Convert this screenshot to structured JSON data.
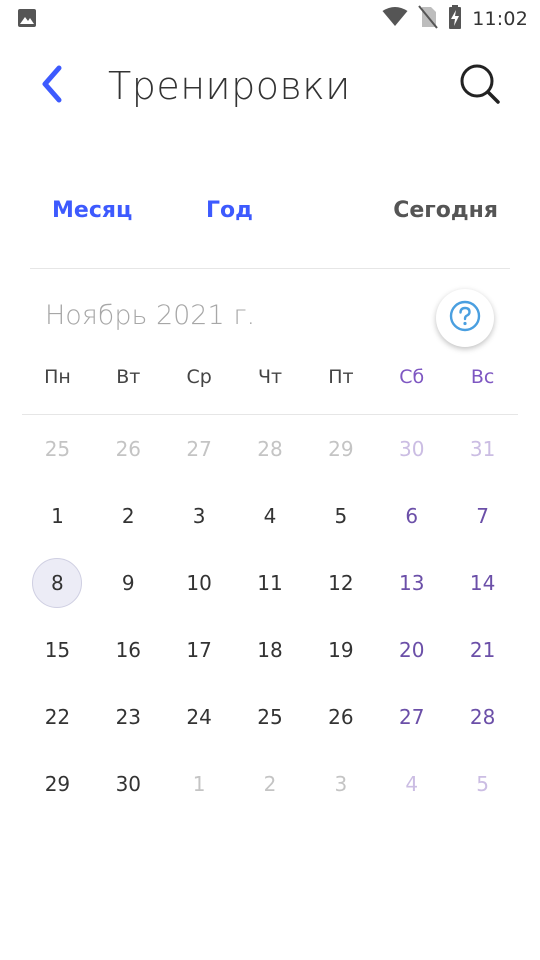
{
  "status_bar": {
    "time": "11:02",
    "left_icon": "image-icon",
    "icons": [
      "wifi-icon",
      "no-sim-icon",
      "battery-charging-icon"
    ]
  },
  "app_bar": {
    "title": "Тренировки",
    "back_icon": "back-arrow-icon",
    "search_icon": "search-icon",
    "accent_color": "#3D5AFE"
  },
  "tabs": {
    "month": "Месяц",
    "year": "Год",
    "today": "Сегодня"
  },
  "calendar": {
    "month_title": "Ноябрь 2021 г.",
    "help_icon": "help-circle-icon",
    "weekdays": [
      "Пн",
      "Вт",
      "Ср",
      "Чт",
      "Пт",
      "Сб",
      "Вс"
    ],
    "weeks": [
      [
        {
          "day": "25",
          "muted": true
        },
        {
          "day": "26",
          "muted": true
        },
        {
          "day": "27",
          "muted": true
        },
        {
          "day": "28",
          "muted": true
        },
        {
          "day": "29",
          "muted": true
        },
        {
          "day": "30",
          "muted": true
        },
        {
          "day": "31",
          "muted": true
        }
      ],
      [
        {
          "day": "1"
        },
        {
          "day": "2"
        },
        {
          "day": "3"
        },
        {
          "day": "4"
        },
        {
          "day": "5"
        },
        {
          "day": "6"
        },
        {
          "day": "7"
        }
      ],
      [
        {
          "day": "8",
          "today": true
        },
        {
          "day": "9"
        },
        {
          "day": "10"
        },
        {
          "day": "11"
        },
        {
          "day": "12"
        },
        {
          "day": "13"
        },
        {
          "day": "14"
        }
      ],
      [
        {
          "day": "15"
        },
        {
          "day": "16"
        },
        {
          "day": "17"
        },
        {
          "day": "18"
        },
        {
          "day": "19"
        },
        {
          "day": "20"
        },
        {
          "day": "21"
        }
      ],
      [
        {
          "day": "22"
        },
        {
          "day": "23"
        },
        {
          "day": "24"
        },
        {
          "day": "25"
        },
        {
          "day": "26"
        },
        {
          "day": "27"
        },
        {
          "day": "28"
        }
      ],
      [
        {
          "day": "29"
        },
        {
          "day": "30"
        },
        {
          "day": "1",
          "muted": true
        },
        {
          "day": "2",
          "muted": true
        },
        {
          "day": "3",
          "muted": true
        },
        {
          "day": "4",
          "muted": true
        },
        {
          "day": "5",
          "muted": true
        }
      ]
    ],
    "weekend_color": "#7E57C2",
    "selected_day": "8"
  }
}
